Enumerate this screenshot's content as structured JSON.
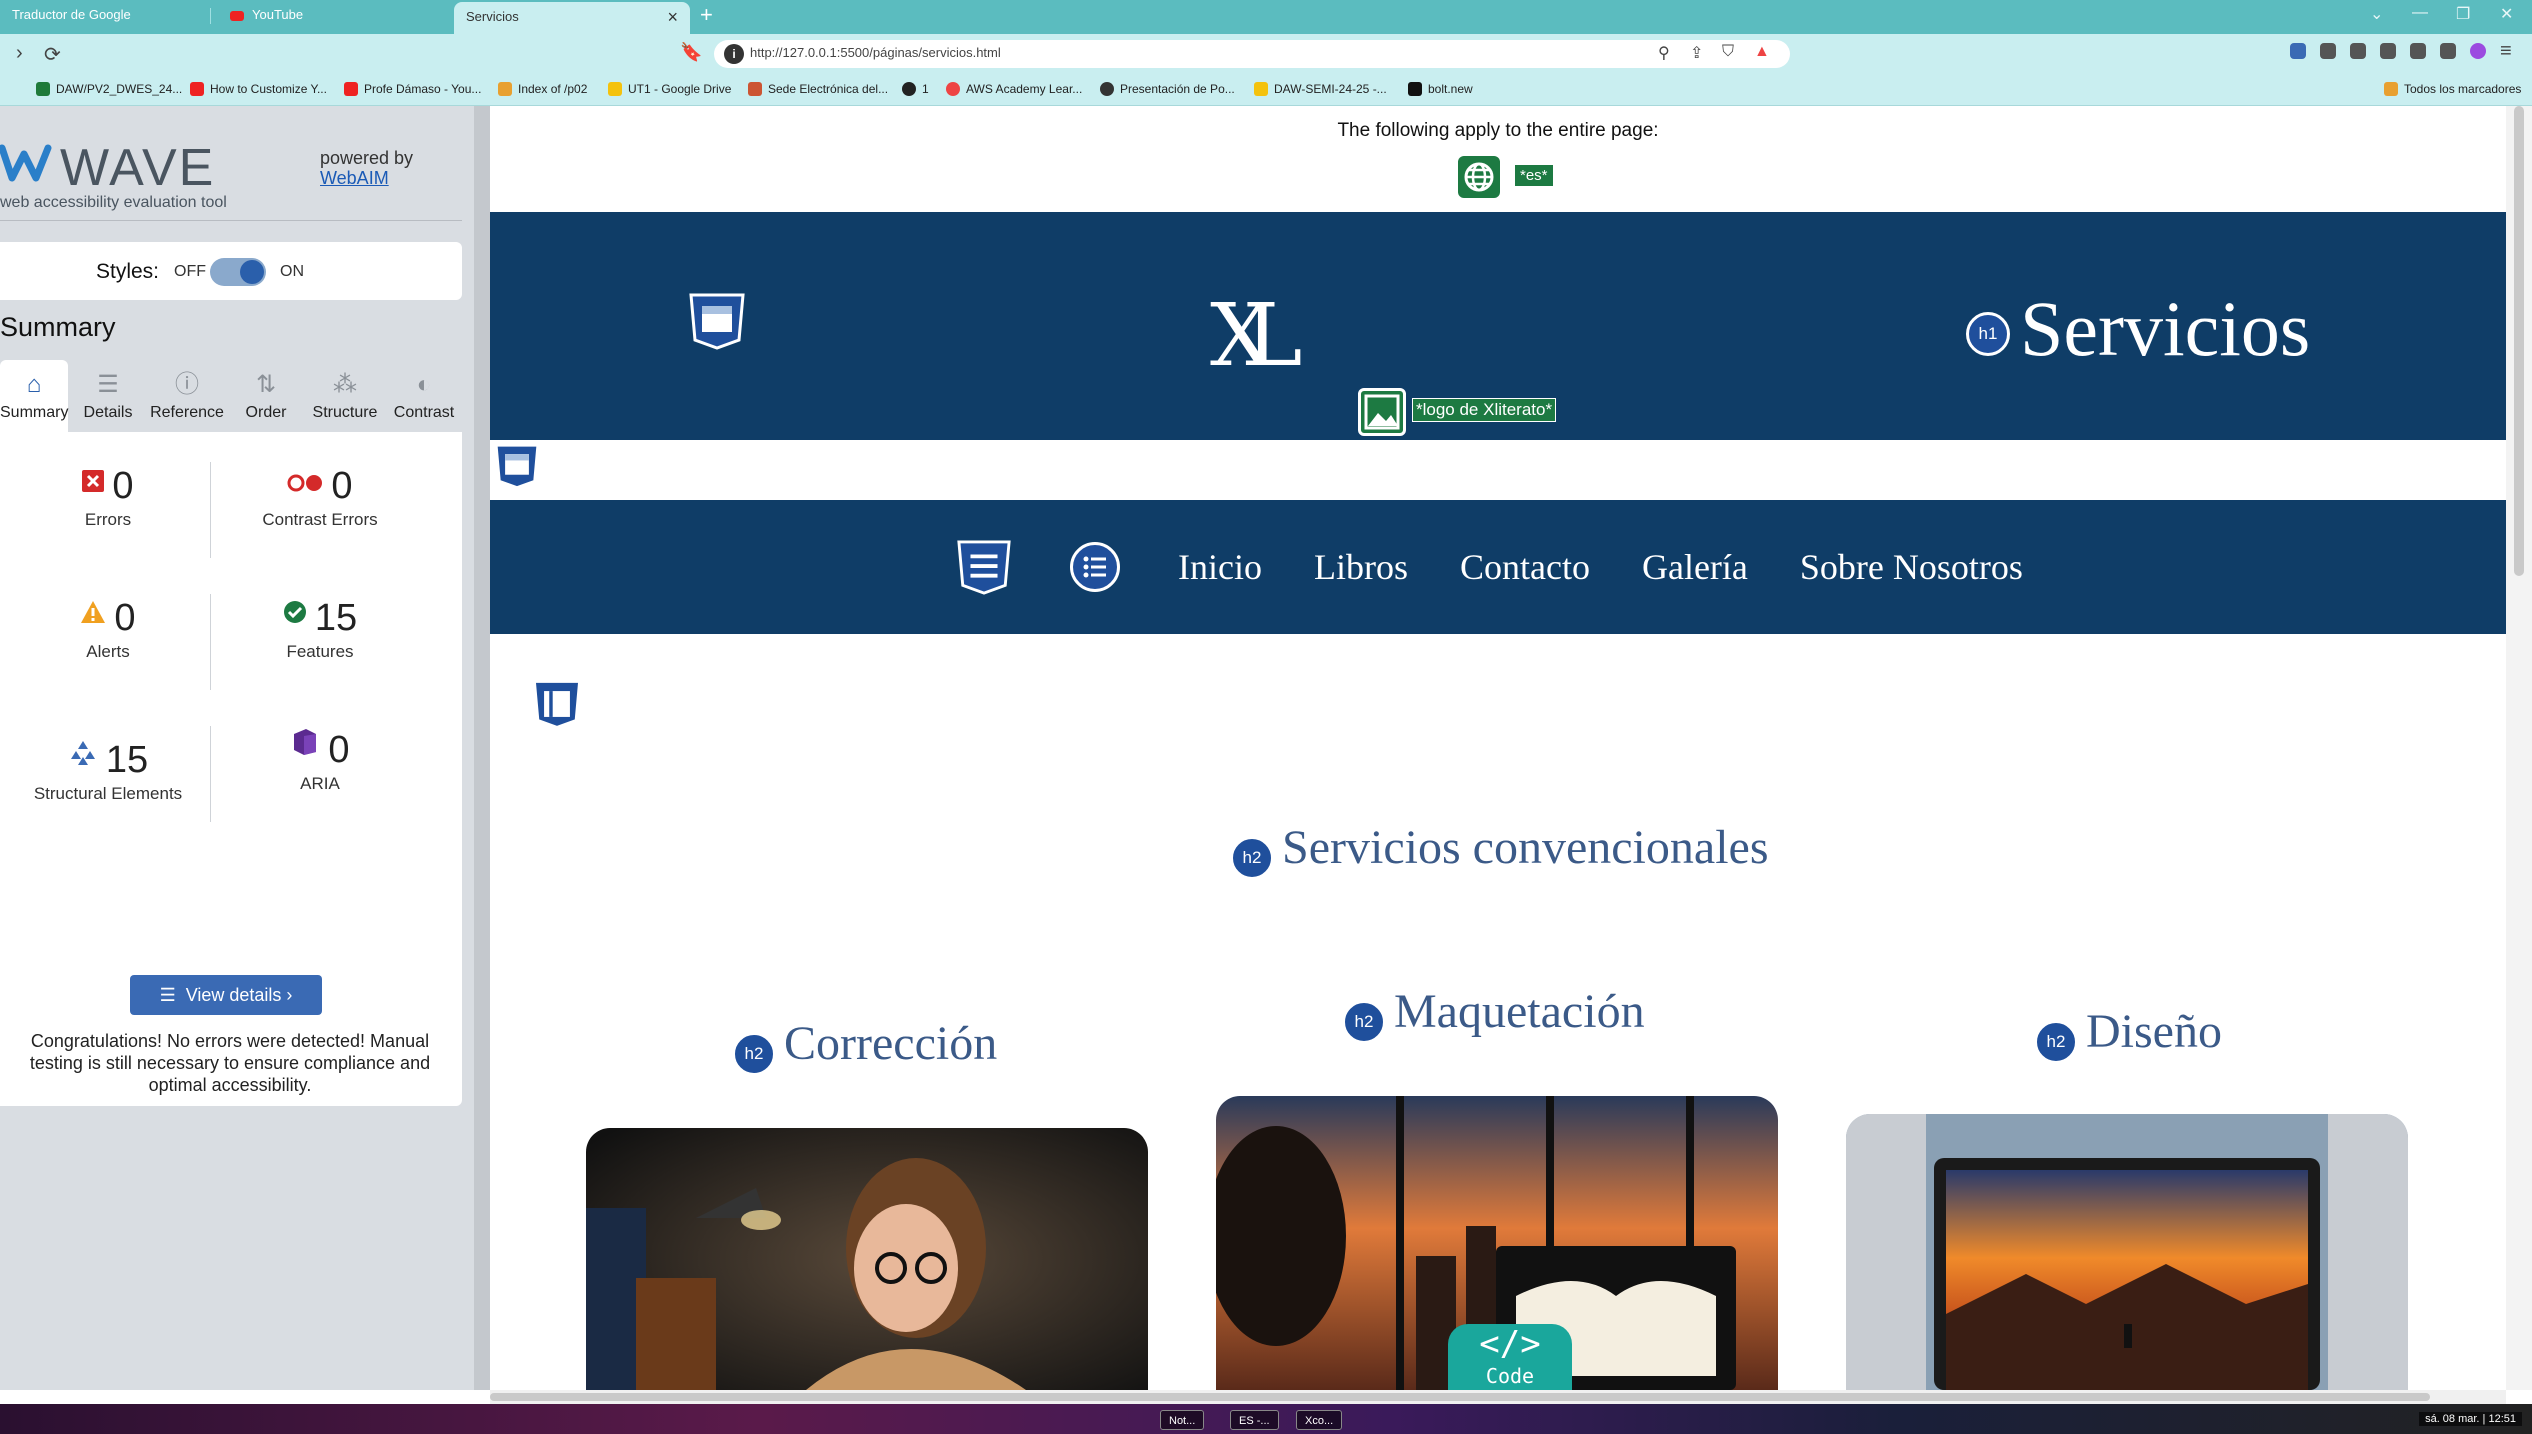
{
  "browser": {
    "tabs": [
      {
        "label": "Traductor de Google",
        "active": false
      },
      {
        "label": "YouTube",
        "active": false
      },
      {
        "label": "Servicios",
        "active": true
      }
    ],
    "url": "http://127.0.0.1:5500/páginas/servicios.html",
    "bookmarks": [
      "DAW/PV2_DWES_24...",
      "How to Customize Y...",
      "Profe Dámaso - You...",
      "Index of /p02",
      "UT1 - Google Drive",
      "Sede Electrónica del...",
      "1",
      "AWS Academy Lear...",
      "Presentación de Po...",
      "DAW-SEMI-24-25 -...",
      "bolt.new"
    ],
    "all_bookmarks": "Todos los marcadores",
    "notification_count": "1"
  },
  "wave": {
    "brand": "WAVE",
    "tagline": "web accessibility evaluation tool",
    "powered_by": "powered by",
    "webaim": "WebAIM",
    "styles_label": "Styles:",
    "styles_off": "OFF",
    "styles_on": "ON",
    "summary_title": "Summary",
    "tabs": [
      {
        "label": "Summary",
        "icon": "home-icon"
      },
      {
        "label": "Details",
        "icon": "list-icon"
      },
      {
        "label": "Reference",
        "icon": "info-icon"
      },
      {
        "label": "Order",
        "icon": "order-icon"
      },
      {
        "label": "Structure",
        "icon": "structure-icon"
      },
      {
        "label": "Contrast",
        "icon": "contrast-icon"
      }
    ],
    "stats": {
      "errors": {
        "value": "0",
        "label": "Errors"
      },
      "contrast_errors": {
        "value": "0",
        "label": "Contrast Errors"
      },
      "alerts": {
        "value": "0",
        "label": "Alerts"
      },
      "features": {
        "value": "15",
        "label": "Features"
      },
      "structural": {
        "value": "15",
        "label": "Structural Elements"
      },
      "aria": {
        "value": "0",
        "label": "ARIA"
      }
    },
    "view_details": "View details ›",
    "congrats": "Congratulations! No errors were detected! Manual testing is still necessary to ensure compliance and optimal accessibility."
  },
  "page": {
    "applies": "The following apply to the entire page:",
    "lang_tag": "*es*",
    "logo_text": "XL",
    "logo_alt": "*logo de Xliterato*",
    "h1_badge": "h1",
    "h1": "Servicios",
    "nav": [
      "Inicio",
      "Libros",
      "Contacto",
      "Galería",
      "Sobre Nosotros"
    ],
    "h2_badge": "h2",
    "h2_main": "Servicios convencionales",
    "cards": [
      {
        "title": "Corrección"
      },
      {
        "title": "Maquetación"
      },
      {
        "title": "Diseño"
      }
    ],
    "code_badge": "Code"
  },
  "taskbar": {
    "items": [
      "Not...",
      "ES -...",
      "Xco..."
    ],
    "clock": "sá. 08 mar. | 12:51"
  },
  "colors": {
    "tabbar": "#5bbcbf",
    "chrome": "#c9eef0",
    "header_band": "#0f3d67",
    "wave_blue": "#2a5fab",
    "feature_green": "#1d7a42",
    "h2_color": "#3b5a88"
  }
}
